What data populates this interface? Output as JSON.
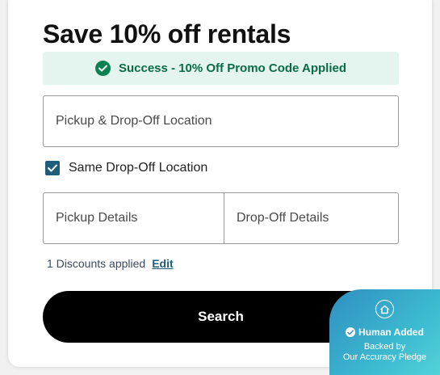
{
  "form": {
    "title": "Save 10% off rentals",
    "success_message": "Success - 10% Off Promo Code Applied",
    "pickup_dropoff_placeholder": "Pickup & Drop-Off Location",
    "same_dropoff_label": "Same Drop-Off Location",
    "same_dropoff_checked": true,
    "pickup_details_placeholder": "Pickup Details",
    "dropoff_details_placeholder": "Drop-Off Details",
    "discounts_text": "1 Discounts applied",
    "edit_label": "Edit",
    "search_label": "Search"
  },
  "badge": {
    "title": "Human Added",
    "line1": "Backed by",
    "line2": "Our Accuracy Pledge"
  },
  "colors": {
    "success_bg": "#e4f5ef",
    "success_text": "#0b6b47",
    "checkbox": "#1f5e7a",
    "button": "#000000"
  },
  "icons": [
    "check-circle-icon",
    "checkbox-check-icon",
    "home-icon",
    "verified-icon"
  ]
}
